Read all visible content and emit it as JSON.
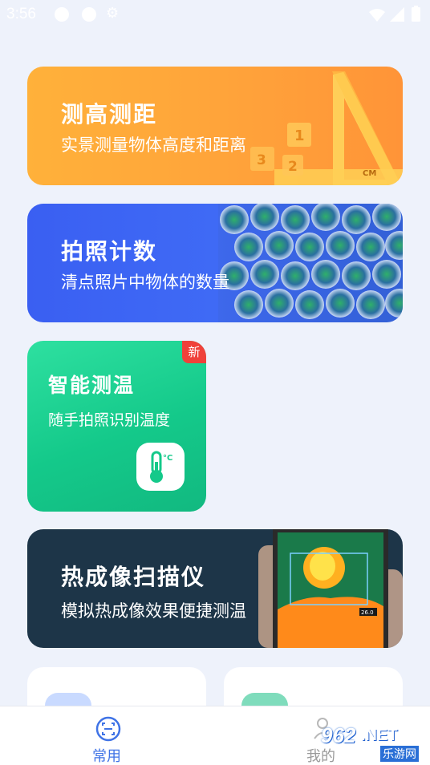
{
  "status_bar": {
    "time": "3:56"
  },
  "cards": {
    "measure": {
      "title": "测高测距",
      "subtitle": "实景测量物体高度和距离",
      "digits": [
        "1",
        "2",
        "3"
      ],
      "ruler_unit": "CM"
    },
    "count": {
      "title": "拍照计数",
      "subtitle": "清点照片中物体的数量"
    },
    "temperature": {
      "title": "智能测温",
      "subtitle": "随手拍照识别温度",
      "badge": "新",
      "icon_unit": "°C"
    },
    "thermal": {
      "title": "热成像扫描仪",
      "subtitle": "模拟热成像效果便捷测温",
      "reading": "26.0"
    }
  },
  "bottom_nav": {
    "items": [
      {
        "label": "常用",
        "icon": "scan-icon",
        "active": true
      },
      {
        "label": "我的",
        "icon": "user-icon",
        "active": false
      }
    ]
  },
  "watermark": {
    "number": "962",
    "domain": ".NET",
    "site": "乐游网"
  },
  "colors": {
    "accent": "#3f73e6",
    "measure": "#ffa33a",
    "count": "#3f6af5",
    "temperature": "#14c98a",
    "thermal": "#1d3548",
    "badge": "#f0413a"
  }
}
